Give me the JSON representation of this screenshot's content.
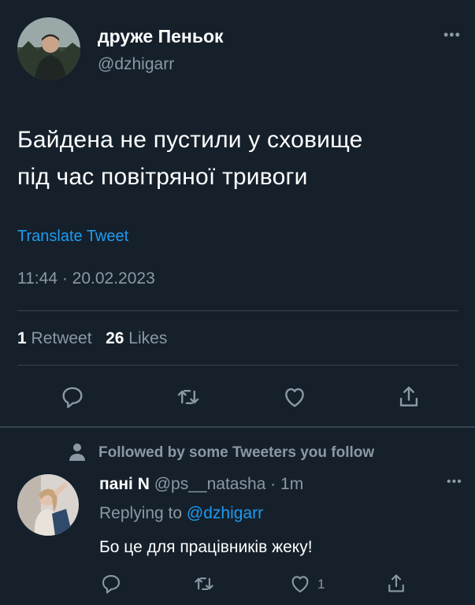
{
  "tweet": {
    "author_name": "друже Пеньок",
    "author_handle": "@dzhigarr",
    "more_glyph": "•••",
    "text_line1": "Байдена не пустили у сховище",
    "text_line2": "під час повітряної тривоги",
    "translate_label": "Translate Tweet",
    "timestamp": "11:44 · 20.02.2023",
    "retweet_count": "1",
    "retweet_label": "Retweet",
    "like_count": "26",
    "like_label": "Likes"
  },
  "social_context": {
    "label": "Followed by some Tweeters you follow"
  },
  "reply": {
    "author_name": "пані N",
    "author_handle": "@ps__natasha",
    "time_sep": "·",
    "time": "1m",
    "more_glyph": "•••",
    "replying_prefix": "Replying to",
    "replying_handle": "@dzhigarr",
    "text": "Бо це для працівників жеку!",
    "like_count": "1"
  },
  "colors": {
    "background": "#15202b",
    "accent": "#1d9bf0",
    "muted": "#8b98a5",
    "divider": "#38444d"
  },
  "icons": [
    "reply-icon",
    "retweet-icon",
    "like-icon",
    "share-icon",
    "person-icon"
  ]
}
